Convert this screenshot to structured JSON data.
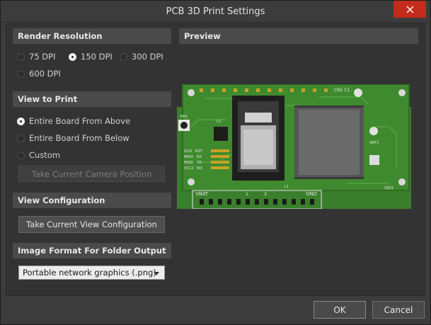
{
  "window": {
    "title": "PCB 3D Print Settings"
  },
  "render_resolution": {
    "header": "Render Resolution",
    "options": [
      "75 DPI",
      "150 DPI",
      "300 DPI",
      "600 DPI"
    ],
    "selected": "150 DPI"
  },
  "view_to_print": {
    "header": "View to Print",
    "options": [
      "Entire Board From Above",
      "Entire Board From Below",
      "Custom"
    ],
    "selected": "Entire Board From Above",
    "camera_button": "Take Current Camera Position"
  },
  "view_configuration": {
    "header": "View Configuration",
    "button": "Take Current View Configuration"
  },
  "image_format": {
    "header": "Image Format For Folder Output",
    "value": "Portable network graphics (.png)"
  },
  "preview": {
    "header": "Preview",
    "board_labels": {
      "vbat": "VBAT",
      "gnd": "GND",
      "pins": [
        "1",
        "3"
      ],
      "signals": [
        "DCD",
        "RST",
        "MISO",
        "RX",
        "MOSI",
        "TX",
        "VCC2",
        "NO"
      ],
      "led": "LED1",
      "sw": "SW1",
      "chip": "C1",
      "top": "CN1 C1",
      "l1": "L1",
      "ant": "ANT1"
    }
  },
  "footer": {
    "ok": "OK",
    "cancel": "Cancel"
  },
  "colors": {
    "accent_close": "#c42b1c",
    "pcb_green": "#3f8a2e",
    "pcb_dark": "#2f6d22",
    "silkscreen": "#e8e8e8",
    "pad_gold": "#c9a227"
  }
}
